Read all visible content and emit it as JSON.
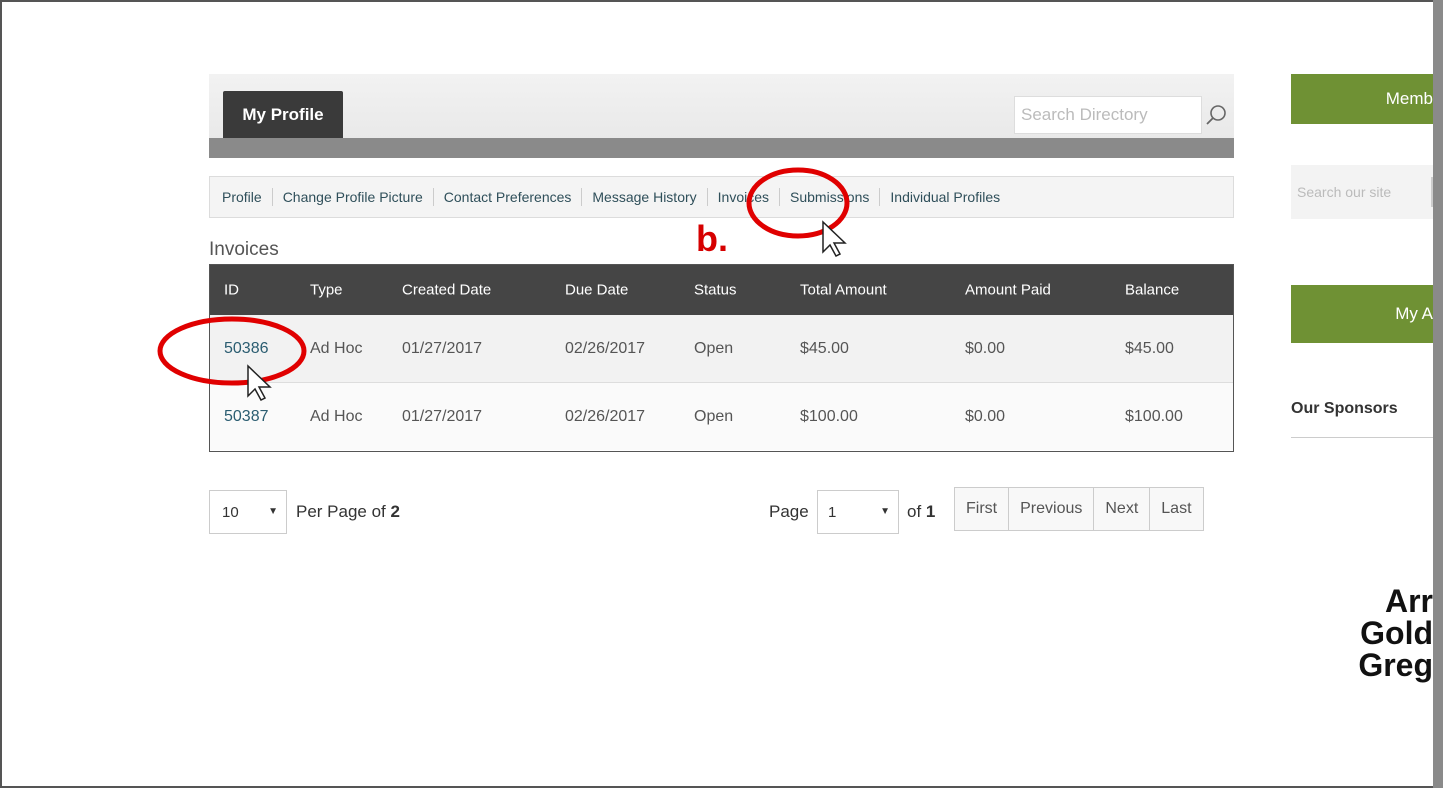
{
  "header": {
    "tab_label": "My Profile",
    "search_placeholder": "Search Directory"
  },
  "subnav": [
    {
      "label": "Profile"
    },
    {
      "label": "Change Profile Picture"
    },
    {
      "label": "Contact Preferences"
    },
    {
      "label": "Message History"
    },
    {
      "label": "Invoices"
    },
    {
      "label": "Submissions"
    },
    {
      "label": "Individual Profiles"
    }
  ],
  "section_title": "Invoices",
  "table": {
    "headers": [
      "ID",
      "Type",
      "Created Date",
      "Due Date",
      "Status",
      "Total Amount",
      "Amount Paid",
      "Balance"
    ],
    "rows": [
      {
        "id": "50386",
        "type": "Ad Hoc",
        "created": "01/27/2017",
        "due": "02/26/2017",
        "status": "Open",
        "total": "$45.00",
        "paid": "$0.00",
        "balance": "$45.00"
      },
      {
        "id": "50387",
        "type": "Ad Hoc",
        "created": "01/27/2017",
        "due": "02/26/2017",
        "status": "Open",
        "total": "$100.00",
        "paid": "$0.00",
        "balance": "$100.00"
      }
    ]
  },
  "pagination": {
    "per_page_value": "10",
    "per_page_prefix": "Per Page of",
    "total_items": "2",
    "page_label": "Page",
    "page_value": "1",
    "of_label": "of",
    "total_pages": "1",
    "buttons": [
      "First",
      "Previous",
      "Next",
      "Last"
    ]
  },
  "sidebar": {
    "member_button": "Memb",
    "site_search_placeholder": "Search our site",
    "account_button": "My A",
    "sponsors_heading": "Our Sponsors",
    "sponsor_logo_lines": [
      "Arr",
      "Gold",
      "Greg"
    ]
  },
  "annotation": {
    "step_label": "b.",
    "color": "#e00000"
  }
}
